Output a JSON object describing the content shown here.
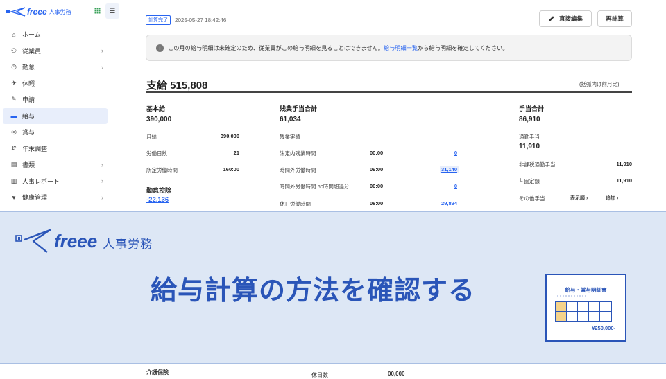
{
  "sidebar": {
    "logo_text": "freee",
    "logo_sub": "人事労務",
    "items": [
      {
        "label": "ホーム",
        "icon": "home-icon",
        "chevron": false,
        "active": false
      },
      {
        "label": "従業員",
        "icon": "employee-icon",
        "chevron": true,
        "active": false
      },
      {
        "label": "勤怠",
        "icon": "attendance-icon",
        "chevron": true,
        "active": false
      },
      {
        "label": "休暇",
        "icon": "vacation-icon",
        "chevron": false,
        "active": false
      },
      {
        "label": "申請",
        "icon": "request-icon",
        "chevron": false,
        "active": false
      },
      {
        "label": "給与",
        "icon": "salary-icon",
        "chevron": false,
        "active": true
      },
      {
        "label": "賞与",
        "icon": "bonus-icon",
        "chevron": false,
        "active": false
      },
      {
        "label": "年末調整",
        "icon": "year-end-icon",
        "chevron": false,
        "active": false
      },
      {
        "label": "書類",
        "icon": "document-icon",
        "chevron": true,
        "active": false
      },
      {
        "label": "人事レポート",
        "icon": "report-icon",
        "chevron": true,
        "active": false
      },
      {
        "label": "健康管理",
        "icon": "health-icon",
        "chevron": true,
        "active": false
      }
    ]
  },
  "header": {
    "status_badge": "計算完了",
    "timestamp": "2025-05-27 18:42:46",
    "edit_button": "直接編集",
    "recalc_button": "再計算"
  },
  "notice": {
    "text_before": "この月の給与明細は未確定のため、従業員がこの給与明細を見ることはできません。",
    "link": "給与明細一覧",
    "text_after": "から給与明細を確定してください。"
  },
  "payment": {
    "title": "支給 515,808",
    "note": "(括弧内は前月比)"
  },
  "basic": {
    "title": "基本給",
    "total": "390,000",
    "rows": [
      {
        "label": "月給",
        "value": "390,000"
      },
      {
        "label": "労働日数",
        "value": "21"
      },
      {
        "label": "所定労働時間",
        "value": "160:00"
      }
    ],
    "deduction_title": "勤怠控除",
    "deduction_value": "-22,136"
  },
  "overtime": {
    "title": "残業手当合計",
    "total": "61,034",
    "sub": "残業実績",
    "rows": [
      {
        "label": "法定内残業時間",
        "time": "00:00",
        "amount": "0"
      },
      {
        "label": "時間外労働時間",
        "time": "09:00",
        "amount": "31,140"
      },
      {
        "label": "時間外労働時間 60時間超過分",
        "time": "00:00",
        "amount": "0"
      },
      {
        "label": "休日労働時間",
        "time": "08:00",
        "amount": "29,894"
      }
    ]
  },
  "allowance": {
    "title": "手当合計",
    "total": "86,910",
    "commute_title": "通勤手当",
    "commute_total": "11,910",
    "rows": [
      {
        "label": "非課税通勤手当",
        "value": "11,910"
      },
      {
        "label": "└ 固定額",
        "value": "11,910"
      }
    ],
    "other_label": "その他手当",
    "order_label": "表示順",
    "add_label": "追加"
  },
  "banner": {
    "logo_text": "freee",
    "logo_sub": "人事労務",
    "title": "給与計算の方法を確認する",
    "card_title": "給与・賞与明細書",
    "card_amount": "¥250,000-"
  },
  "bottom": {
    "left": "介護保険",
    "right_label": "休日数",
    "right_value": "00,000"
  },
  "colors": {
    "brand": "#2864f0",
    "banner_blue": "#2a55b8",
    "banner_bg": "#dde7f5"
  }
}
